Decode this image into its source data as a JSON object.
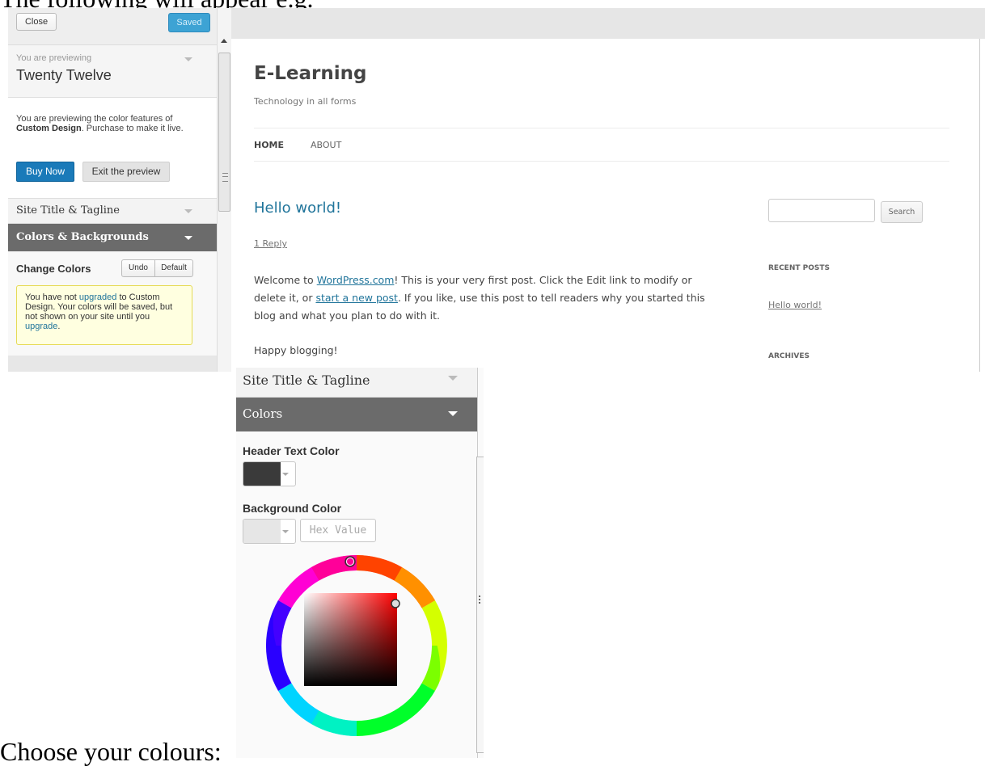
{
  "captions": {
    "top": "The following will appear e.g.",
    "bottom": "Choose your colours:"
  },
  "sidebar": {
    "close_label": "Close",
    "saved_label": "Saved",
    "previewing_label": "You are previewing",
    "theme_name": "Twenty Twelve",
    "notice": {
      "prefix": "You are previewing the color features of",
      "product": "Custom Design",
      "suffix": ". Purchase to make it live."
    },
    "buy_now_label": "Buy Now",
    "exit_preview_label": "Exit the preview",
    "section_site_title": "Site Title & Tagline",
    "section_colors": "Colors & Backgrounds",
    "change_colors_label": "Change Colors",
    "undo_label": "Undo",
    "default_label": "Default",
    "warning": {
      "part1": "You have not ",
      "link1": "upgraded",
      "part2": " to Custom Design. Your colors will be saved, but not shown on your site until you ",
      "link2": "upgrade",
      "part3": "."
    }
  },
  "site": {
    "title": "E-Learning",
    "tagline": "Technology in all forms",
    "nav": [
      "HOME",
      "ABOUT"
    ],
    "post": {
      "title": "Hello world!",
      "reply": "1 Reply",
      "p1_a": "Welcome to ",
      "p1_link": "WordPress.com",
      "p1_b": "! This is your very first post. Click the Edit link to modify or delete it, or ",
      "p1_link2": "start a new post",
      "p1_c": ". If you like, use this post to tell readers why you started this blog and what you plan to do with it.",
      "p2": "Happy blogging!"
    },
    "search_button": "Search",
    "widgets": {
      "recent_posts": "RECENT POSTS",
      "recent_link": "Hello world!",
      "archives": "ARCHIVES"
    }
  },
  "panel2": {
    "section_site_title": "Site Title & Tagline",
    "section_colors": "Colors",
    "header_text_color_label": "Header Text Color",
    "header_text_color": "#3a3a3a",
    "background_color_label": "Background Color",
    "background_color": "#e6e6e6",
    "hex_placeholder": "Hex Value"
  }
}
